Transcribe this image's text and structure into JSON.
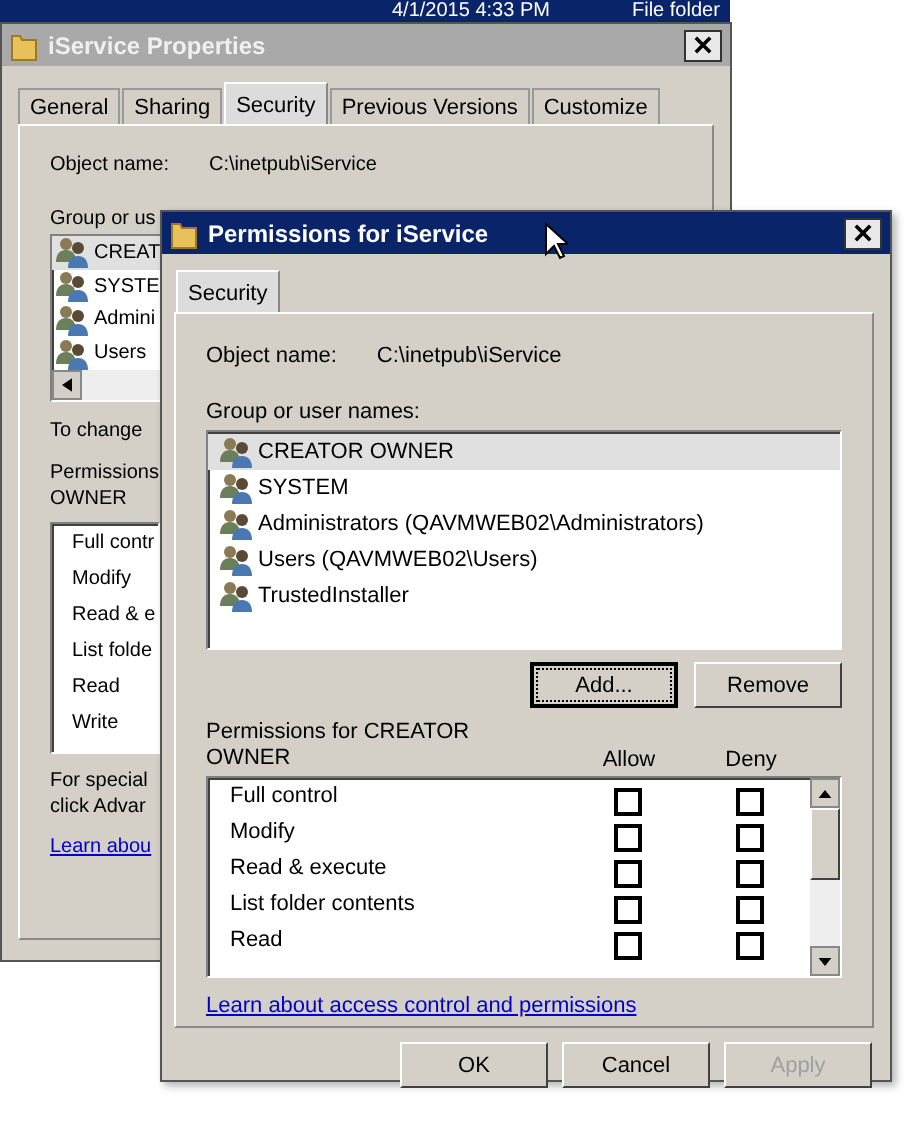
{
  "desktop_bar": {
    "date": "4/1/2015 4:33 PM",
    "type": "File folder"
  },
  "properties_window": {
    "title": "iService Properties",
    "tabs": [
      {
        "label": "General",
        "selected": false
      },
      {
        "label": "Sharing",
        "selected": false
      },
      {
        "label": "Security",
        "selected": true
      },
      {
        "label": "Previous Versions",
        "selected": false
      },
      {
        "label": "Customize",
        "selected": false
      }
    ],
    "object_name_label": "Object name:",
    "object_name": "C:\\inetpub\\iService",
    "group_label": "Group or us",
    "users": [
      {
        "name": "CREAT",
        "selected": true
      },
      {
        "name": "SYSTE",
        "selected": false
      },
      {
        "name": "Admini",
        "selected": false
      },
      {
        "name": "Users",
        "selected": false
      }
    ],
    "change_text": "To change",
    "permissions_label": [
      "Permissions",
      "OWNER"
    ],
    "permissions": [
      "Full contr",
      "Modify",
      "Read & e",
      "List folde",
      "Read",
      "Write"
    ],
    "special_text": [
      "For special",
      "click Advar"
    ],
    "learn_link": "Learn abou"
  },
  "permissions_dialog": {
    "title": "Permissions for iService",
    "tabs": [
      {
        "label": "Security",
        "selected": true
      }
    ],
    "object_name_label": "Object name:",
    "object_name": "C:\\inetpub\\iService",
    "group_label": "Group or user names:",
    "users": [
      {
        "name": "CREATOR OWNER",
        "selected": true
      },
      {
        "name": "SYSTEM",
        "selected": false
      },
      {
        "name": "Administrators (QAVMWEB02\\Administrators)",
        "selected": false
      },
      {
        "name": "Users (QAVMWEB02\\Users)",
        "selected": false
      },
      {
        "name": "TrustedInstaller",
        "selected": false
      }
    ],
    "add_button": "Add...",
    "remove_button": "Remove",
    "permissions_label": [
      "Permissions for CREATOR",
      "OWNER"
    ],
    "allow_header": "Allow",
    "deny_header": "Deny",
    "permissions": [
      {
        "name": "Full control",
        "allow": false,
        "deny": false
      },
      {
        "name": "Modify",
        "allow": false,
        "deny": false
      },
      {
        "name": "Read & execute",
        "allow": false,
        "deny": false
      },
      {
        "name": "List folder contents",
        "allow": false,
        "deny": false
      },
      {
        "name": "Read",
        "allow": false,
        "deny": false
      }
    ],
    "learn_link": "Learn about access control and permissions",
    "buttons": [
      {
        "label": "OK",
        "disabled": false
      },
      {
        "label": "Cancel",
        "disabled": false
      },
      {
        "label": "Apply",
        "disabled": true
      }
    ]
  }
}
